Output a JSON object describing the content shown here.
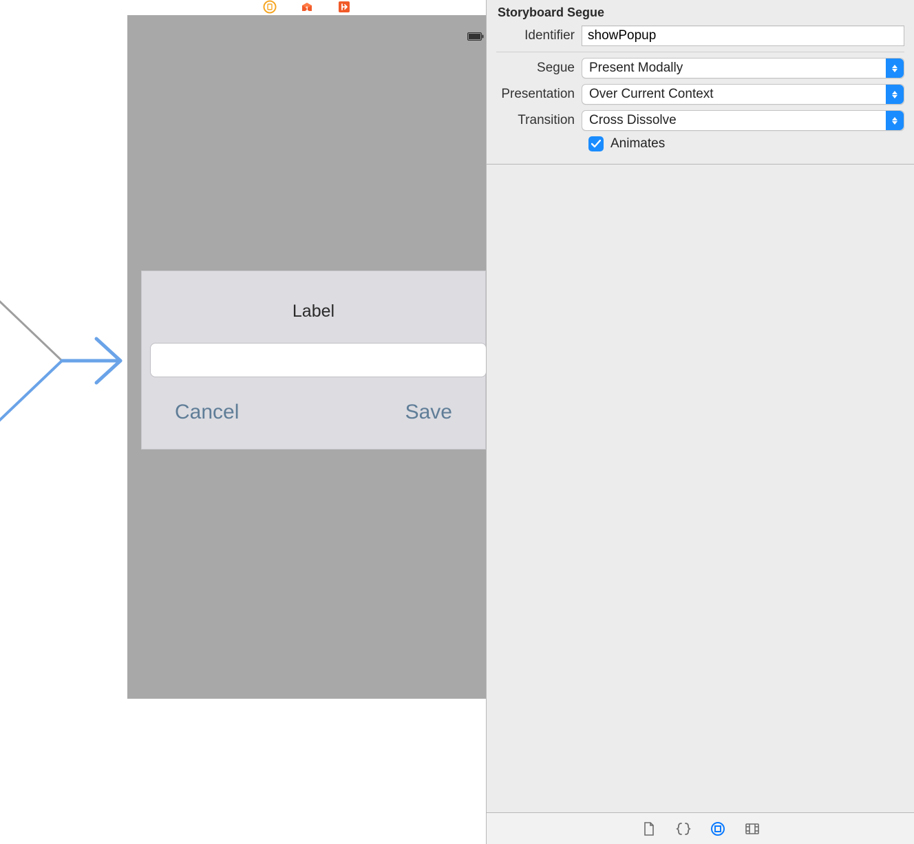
{
  "inspector": {
    "section_title": "Storyboard Segue",
    "identifier_label": "Identifier",
    "identifier_value": "showPopup",
    "segue_label": "Segue",
    "segue_value": "Present Modally",
    "presentation_label": "Presentation",
    "presentation_value": "Over Current Context",
    "transition_label": "Transition",
    "transition_value": "Cross Dissolve",
    "animates_label": "Animates",
    "animates_checked": true
  },
  "popup": {
    "title": "Label",
    "input_value": "",
    "cancel_label": "Cancel",
    "save_label": "Save"
  },
  "icons": {
    "vc_icon": "viewcontroller-icon",
    "first_responder_icon": "first-responder-icon",
    "exit_icon": "exit-icon"
  }
}
